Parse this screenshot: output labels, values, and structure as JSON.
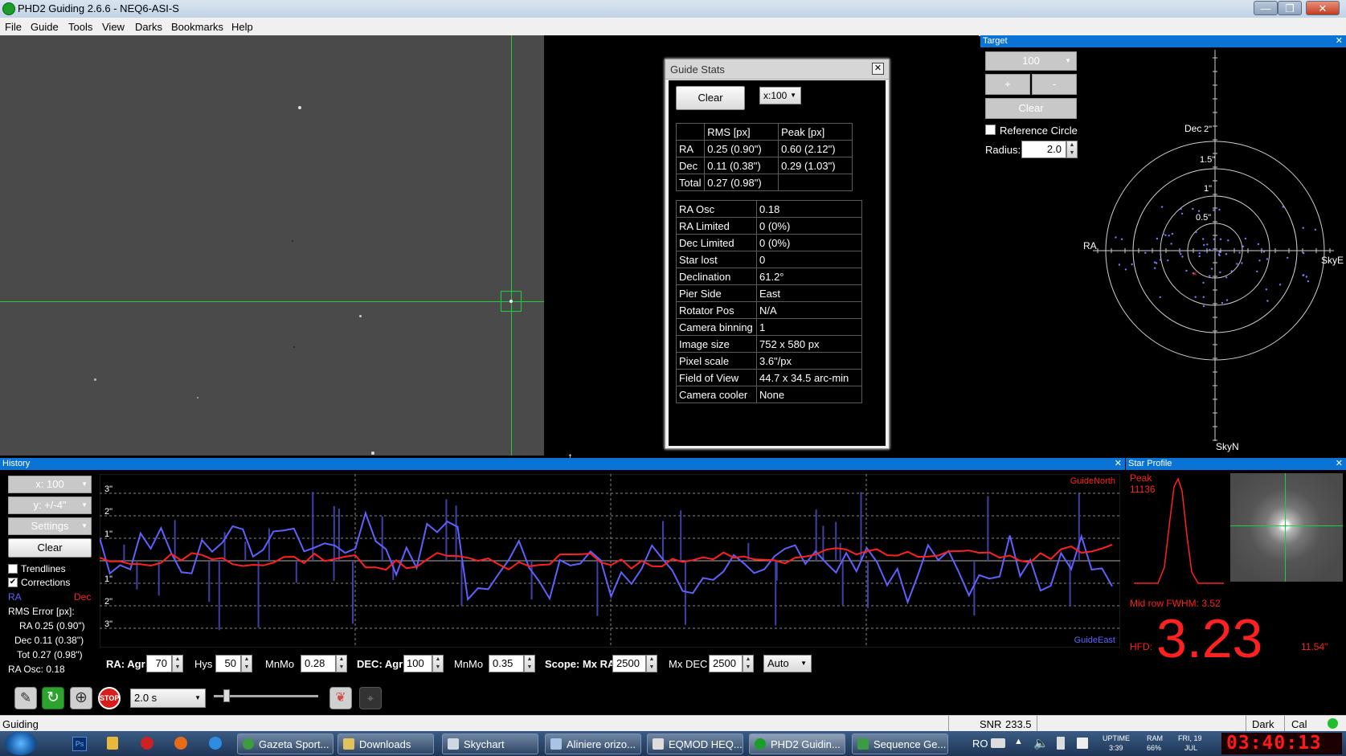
{
  "window": {
    "title": "PHD2 Guiding 2.6.6 - NEQ6-ASI-S",
    "minimize": "—",
    "maximize": "❐",
    "close": "✕"
  },
  "menu": [
    "File",
    "Guide",
    "Tools",
    "View",
    "Darks",
    "Bookmarks",
    "Help"
  ],
  "guide_stats": {
    "title": "Guide Stats",
    "clear_label": "Clear",
    "scale_value": "x:100",
    "headers": [
      "",
      "RMS [px]",
      "Peak [px]"
    ],
    "rows": [
      [
        "RA",
        "0.25 (0.90\")",
        "0.60 (2.12\")"
      ],
      [
        "Dec",
        "0.11 (0.38\")",
        "0.29 (1.03\")"
      ],
      [
        "Total",
        "0.27 (0.98\")",
        ""
      ]
    ],
    "info": [
      [
        "RA Osc",
        "0.18"
      ],
      [
        "RA Limited",
        "0 (0%)"
      ],
      [
        "Dec Limited",
        "0 (0%)"
      ],
      [
        "Star lost",
        "0"
      ],
      [
        "Declination",
        "61.2°"
      ],
      [
        "Pier Side",
        "East"
      ],
      [
        "Rotator Pos",
        "N/A"
      ],
      [
        "Camera binning",
        "1"
      ],
      [
        "Image size",
        "752 x 580 px"
      ],
      [
        "Pixel scale",
        "3.6\"/px"
      ],
      [
        "Field of View",
        "44.7 x  34.5  arc-min"
      ],
      [
        "Camera cooler",
        "None"
      ]
    ]
  },
  "target": {
    "title": "Target",
    "zoom_value": "100",
    "plus_label": "+",
    "minus_label": "-",
    "clear_label": "Clear",
    "reference_circle_label": "Reference Circle",
    "radius_label": "Radius:",
    "radius_value": "2.0",
    "labels": {
      "dec": "Dec",
      "ra": "RA",
      "skye": "SkyE",
      "skyn": "SkyN"
    },
    "ring_labels": [
      "2\"",
      "1.5\"",
      "1\"",
      "0.5\""
    ]
  },
  "history": {
    "title": "History",
    "x_scale": "x: 100",
    "y_scale": "y: +/-4\"",
    "settings_label": "Settings",
    "clear_label": "Clear",
    "trendlines_label": "Trendlines",
    "corrections_label": "Corrections",
    "ra_legend": "RA",
    "dec_legend": "Dec",
    "rms_title": "RMS Error [px]:",
    "rms_ra": "RA 0.25 (0.90\")",
    "rms_dec": "Dec 0.11 (0.38\")",
    "rms_tot": "Tot 0.27 (0.98\")",
    "ra_osc": "RA Osc: 0.18",
    "guide_north": "GuideNorth",
    "guide_east": "GuideEast",
    "y_ticks": [
      "3\"",
      "2\"",
      "1\"",
      "1\"",
      "2\"",
      "3\""
    ],
    "colors": {
      "ra": "#6060ff",
      "dec": "#ff2020"
    }
  },
  "controls": {
    "ra_agr_label": "RA: Agr",
    "ra_agr": "70",
    "hys_label": "Hys",
    "hys": "50",
    "mnmo_label": "MnMo",
    "ra_mnmo": "0.28",
    "dec_agr_label": "DEC: Agr",
    "dec_agr": "100",
    "dec_mnmo": "0.35",
    "scope_label": "Scope: Mx RA",
    "mx_ra": "2500",
    "mx_dec_label": "Mx DEC",
    "mx_dec": "2500",
    "mode": "Auto"
  },
  "star_profile": {
    "title": "Star Profile",
    "peak_label": "Peak",
    "peak_value": "11136",
    "fwhm": "Mid row FWHM: 3.52",
    "hfd_label": "HFD:",
    "hfd_value": "3.23",
    "hfd_arcsec": "11.54\""
  },
  "toolbar": {
    "exposure": "2.0 s",
    "stop_label": "STOP"
  },
  "status": {
    "state": "Guiding",
    "snr_label": "SNR",
    "snr_value": "233.5",
    "dark": "Dark",
    "cal": "Cal"
  },
  "taskbar": {
    "items": [
      "Gazeta Sport...",
      "Downloads",
      "Skychart",
      "Aliniere orizo...",
      "EQMOD HEQ...",
      "PHD2 Guidin...",
      "Sequence Ge..."
    ],
    "lang": "RO",
    "uptime_label": "UPTIME",
    "uptime": "3:39",
    "ram_label": "RAM",
    "ram": "66%",
    "date_day": "FRI, 19",
    "date_month": "JUL",
    "clock": "03:40:13"
  }
}
